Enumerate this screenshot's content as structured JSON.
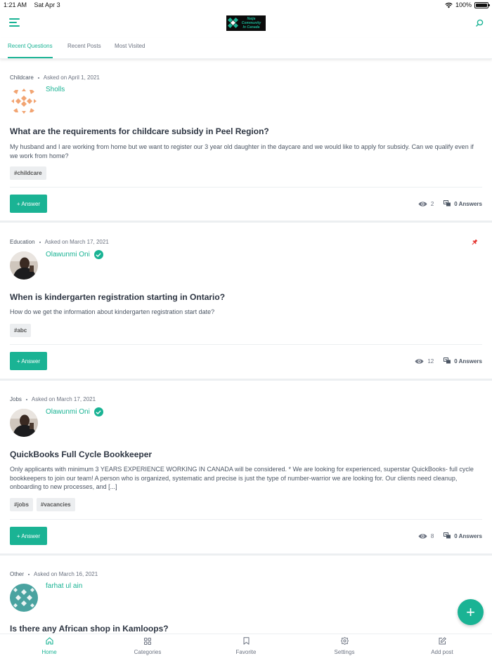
{
  "status_bar": {
    "time": "1:21 AM",
    "date": "Sat Apr 3",
    "battery": "100%"
  },
  "header": {
    "logo_line1": "Naija Community",
    "logo_line2": "In Canada"
  },
  "tabs": [
    {
      "label": "Recent Questions",
      "active": true
    },
    {
      "label": "Recent Posts",
      "active": false
    },
    {
      "label": "Most Visited",
      "active": false
    }
  ],
  "questions": [
    {
      "category": "Childcare",
      "asked": "Asked on April 1, 2021",
      "author": "Sholls",
      "verified": false,
      "pinned": false,
      "title": "What are the requirements for childcare subsidy in Peel Region?",
      "body": "My husband and I are working from home but we want to register our 3 year old daughter in the daycare and we would like to apply for subsidy. Can we qualify even if we work from home?",
      "tags": [
        "#childcare"
      ],
      "answer_label": "+ Answer",
      "views": "2",
      "answers": "0 Answers"
    },
    {
      "category": "Education",
      "asked": "Asked on March 17, 2021",
      "author": "Olawunmi Oni",
      "verified": true,
      "pinned": true,
      "title": "When is kindergarten registration starting in Ontario?",
      "body": "How do we get the information about kindergarten registration start date?",
      "tags": [
        "#abc"
      ],
      "answer_label": "+ Answer",
      "views": "12",
      "answers": "0 Answers"
    },
    {
      "category": "Jobs",
      "asked": "Asked on March 17, 2021",
      "author": "Olawunmi Oni",
      "verified": true,
      "pinned": false,
      "title": "QuickBooks Full Cycle Bookkeeper",
      "body": "Only applicants with minimum 3 YEARS EXPERIENCE WORKING IN CANADA will be considered. * We are looking for experienced, superstar QuickBooks- full cycle bookkeepers to join our team! A person who is organized, systematic and precise is just the type of number-warrior we are looking for. Our clients need cleanup, onboarding to new processes, and [...]",
      "tags": [
        "#jobs",
        "#vacancies"
      ],
      "answer_label": "+ Answer",
      "views": "8",
      "answers": "0 Answers"
    },
    {
      "category": "Other",
      "asked": "Asked on March 16, 2021",
      "author": "farhat ul ain",
      "verified": false,
      "pinned": false,
      "title": "Is there any African shop in Kamloops?"
    }
  ],
  "fab": {
    "label": "+"
  },
  "bottom_nav": [
    {
      "label": "Home",
      "icon": "home-icon",
      "active": true
    },
    {
      "label": "Categories",
      "icon": "grid-icon",
      "active": false
    },
    {
      "label": "Favorite",
      "icon": "bookmark-icon",
      "active": false
    },
    {
      "label": "Settings",
      "icon": "gear-icon",
      "active": false
    },
    {
      "label": "Add post",
      "icon": "edit-icon",
      "active": false
    }
  ],
  "colors": {
    "accent": "#1ab394",
    "text": "#2d3542",
    "pin": "#e53935"
  }
}
